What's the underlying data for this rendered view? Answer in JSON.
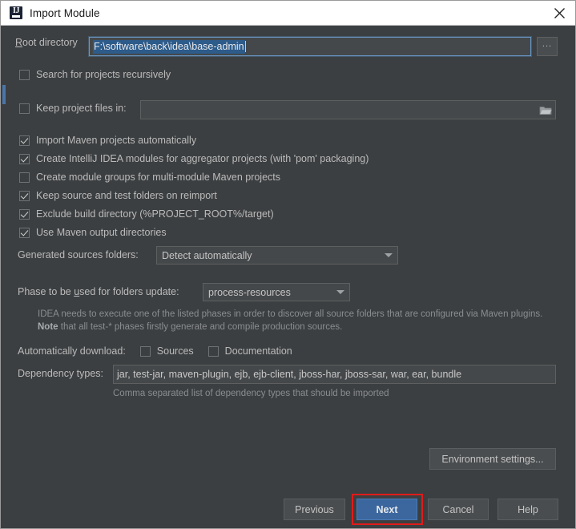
{
  "window": {
    "title": "Import Module",
    "app_icon": "intellij-idea-icon",
    "close_icon": "close-icon"
  },
  "root_directory": {
    "label": "Root directory",
    "label_mnemonic": "R",
    "value": "F:\\software\\back\\idea\\base-admin",
    "selected": true,
    "browse_label": "...",
    "browse_icon": "ellipsis-icon"
  },
  "search_recursively": {
    "label": "Search for projects recursively",
    "label_mnemonic": "S",
    "checked": false
  },
  "keep_project_files": {
    "label": "Keep project files in:",
    "label_mnemonic": "K",
    "checked": false,
    "value": "",
    "placeholder": "",
    "browse_icon": "folder-icon"
  },
  "options": [
    {
      "label": "Import Maven projects automatically",
      "checked": true,
      "mnemonic": "a",
      "name": "import-maven-projects-automatically"
    },
    {
      "label": "Create IntelliJ IDEA modules for aggregator projects (with 'pom' packaging)",
      "checked": true,
      "mnemonic": "m",
      "name": "create-idea-modules-for-aggregator-projects"
    },
    {
      "label": "Create module groups for multi-module Maven projects",
      "checked": false,
      "mnemonic": "g",
      "name": "create-module-groups"
    },
    {
      "label": "Keep source and test folders on reimport",
      "checked": true,
      "mnemonic": "f",
      "name": "keep-source-and-test-folders"
    },
    {
      "label": "Exclude build directory (%PROJECT_ROOT%/target)",
      "checked": true,
      "mnemonic": "",
      "name": "exclude-build-directory"
    },
    {
      "label": "Use Maven output directories",
      "checked": true,
      "mnemonic": "o",
      "name": "use-maven-output-directories"
    }
  ],
  "generated_sources": {
    "label": "Generated sources folders:",
    "value": "Detect automatically"
  },
  "phase": {
    "label": "Phase to be used for folders update:",
    "label_mnemonic": "u",
    "value": "process-resources"
  },
  "phase_hint": {
    "line1": "IDEA needs to execute one of the listed phases in order to discover all source folders that are configured via Maven plugins.",
    "note_bold": "Note",
    "line2_rest": " that all test-* phases firstly generate and compile production sources."
  },
  "auto_download": {
    "label": "Automatically download:",
    "sources": {
      "label": "Sources",
      "checked": false,
      "mnemonic": "r"
    },
    "documentation": {
      "label": "Documentation",
      "checked": false,
      "mnemonic": "D"
    }
  },
  "dependency_types": {
    "label": "Dependency types:",
    "value": "jar, test-jar, maven-plugin, ejb, ejb-client, jboss-har, jboss-sar, war, ear, bundle",
    "hint": "Comma separated list of dependency types that should be imported"
  },
  "environment_settings": {
    "label": "Environment settings..."
  },
  "footer_buttons": {
    "previous": "Previous",
    "next": "Next",
    "cancel": "Cancel",
    "help": "Help"
  },
  "colors": {
    "dialog_background": "#3c3f41",
    "titlebar_background": "#ffffff",
    "primary_button": "#3c679e",
    "annotation_highlight": "#e01b1b",
    "selection": "#2d5b8a",
    "accent_strip": "#4a76a8"
  }
}
